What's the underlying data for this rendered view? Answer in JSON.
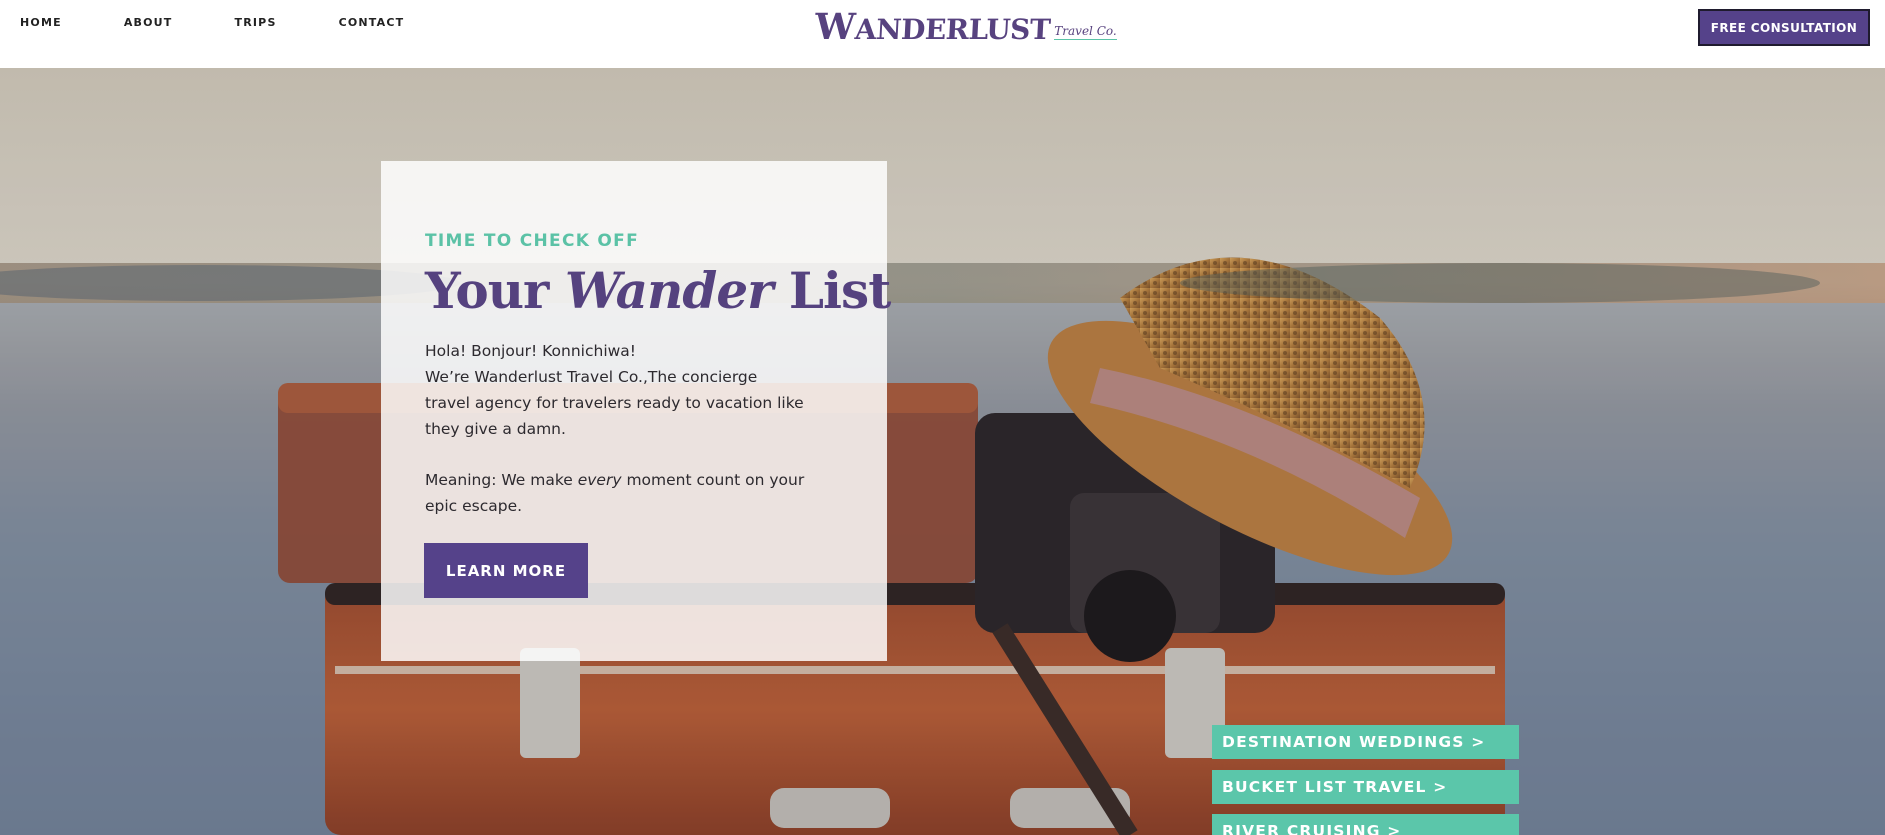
{
  "nav": {
    "items": [
      {
        "label": "HOME"
      },
      {
        "label": "ABOUT"
      },
      {
        "label": "TRIPS"
      },
      {
        "label": "CONTACT"
      }
    ]
  },
  "logo": {
    "first_letter": "W",
    "rest": "ANDERLUST",
    "sub": "Travel Co."
  },
  "header": {
    "cta_label": "FREE CONSULTATION"
  },
  "hero": {
    "eyebrow": "TIME TO CHECK OFF",
    "headline_pre": "Your ",
    "headline_em": "Wander",
    "headline_post": " List",
    "greeting": "Hola! Bonjour! Konnichiwa!",
    "intro": "We’re Wanderlust Travel Co.,The concierge travel agency for travelers ready to vacation like they give a damn.",
    "meaning_pre": "Meaning: We make ",
    "meaning_em": "every",
    "meaning_post": " moment count on your epic escape.",
    "button_label": "LEARN MORE"
  },
  "side_links": [
    {
      "label": "DESTINATION WEDDINGS >"
    },
    {
      "label": "BUCKET LIST TRAVEL >"
    },
    {
      "label": "RIVER CRUISING >"
    }
  ],
  "colors": {
    "brand_purple": "#55428a",
    "accent_teal": "#5bc6aa"
  }
}
